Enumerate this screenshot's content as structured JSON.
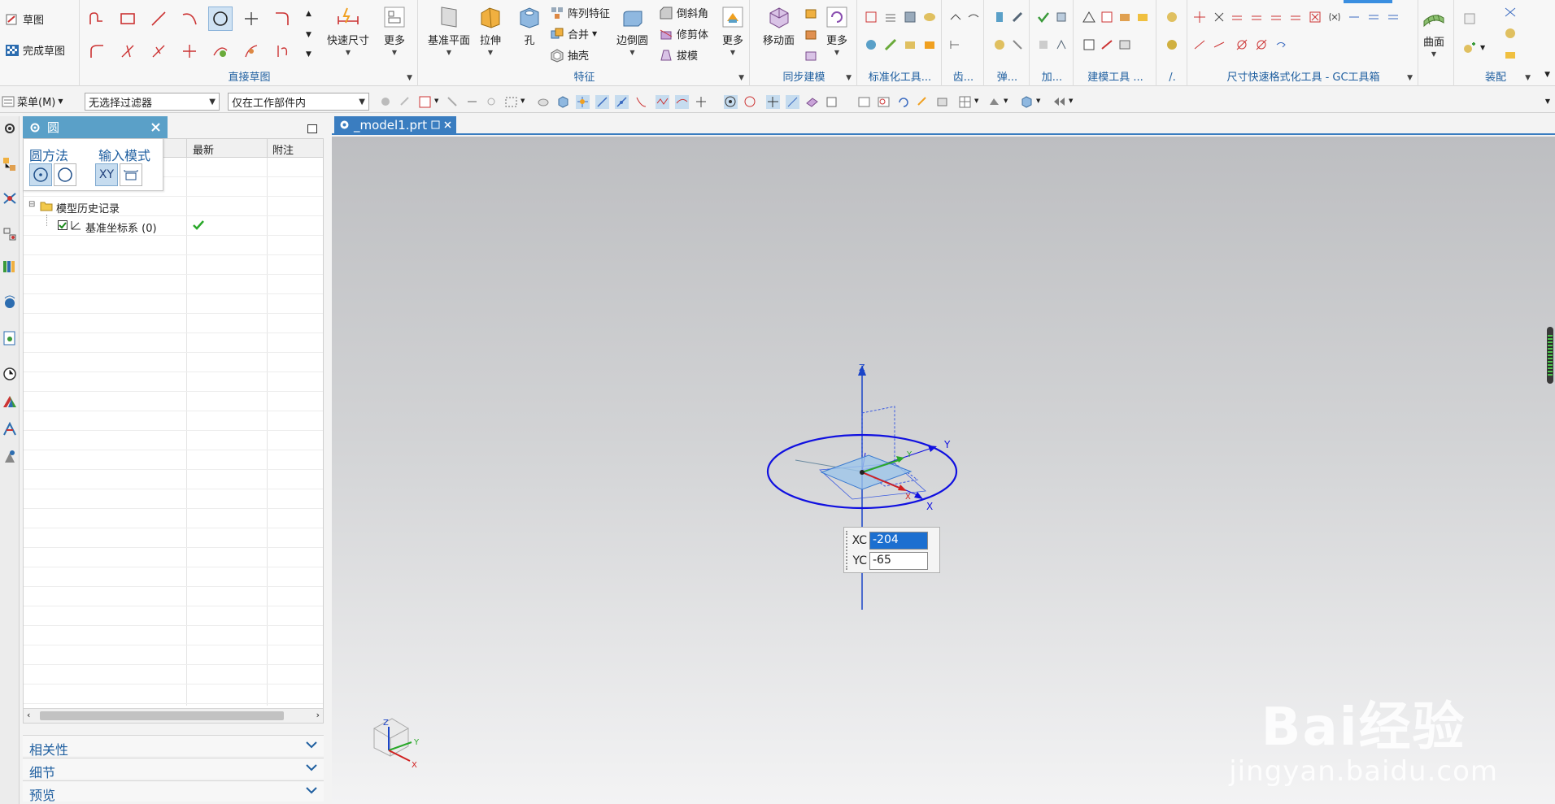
{
  "ribbon": {
    "sketch": {
      "sketch_label": "草图",
      "finish_label": "完成草图"
    },
    "direct_sketch": {
      "group_label": "直接草图",
      "quick_dim_label": "快速尺寸",
      "more_label": "更多"
    },
    "feature": {
      "group_label": "特征",
      "datum_plane_label": "基准平面",
      "extrude_label": "拉伸",
      "hole_label": "孔",
      "pattern_label": "阵列特征",
      "unite_label": "合并",
      "shell_label": "抽壳",
      "edge_blend_label": "边倒圆",
      "chamfer_label": "倒斜角",
      "trim_body_label": "修剪体",
      "draft_label": "拔模",
      "more_label": "更多"
    },
    "sync": {
      "group_label": "同步建模",
      "move_face_label": "移动面",
      "more_label": "更多"
    },
    "small_groups": [
      "标准化工具...",
      "齿...",
      "弹...",
      "加...",
      "建模工具 ...",
      "/."
    ],
    "gc_group_label": "尺寸快速格式化工具 - GC工具箱",
    "surface": {
      "label": "曲面"
    },
    "assembly": {
      "label": "装配"
    }
  },
  "toolbar2": {
    "menu_label": "菜单(M)",
    "filter_value": "无选择过滤器",
    "scope_value": "仅在工作部件内"
  },
  "dialog": {
    "title": "圆",
    "method_label": "圆方法",
    "input_mode_label": "输入模式",
    "xy_label": "XY"
  },
  "navigator": {
    "col_latest": "最新",
    "col_note": "附注",
    "rows": [
      {
        "label": "模型历史记录"
      },
      {
        "label": "基准坐标系 (0)"
      }
    ]
  },
  "sections": [
    {
      "label": "相关性"
    },
    {
      "label": "细节"
    },
    {
      "label": "预览"
    }
  ],
  "tab": {
    "label": "_model1.prt"
  },
  "coords": {
    "xc_label": "XC",
    "xc_value": "-204",
    "yc_label": "YC",
    "yc_value": "-65"
  },
  "axes": {
    "x": "X",
    "y": "Y",
    "z": "Z"
  },
  "watermark": {
    "logo": "Bai经验",
    "url": "jingyan.baidu.com"
  }
}
